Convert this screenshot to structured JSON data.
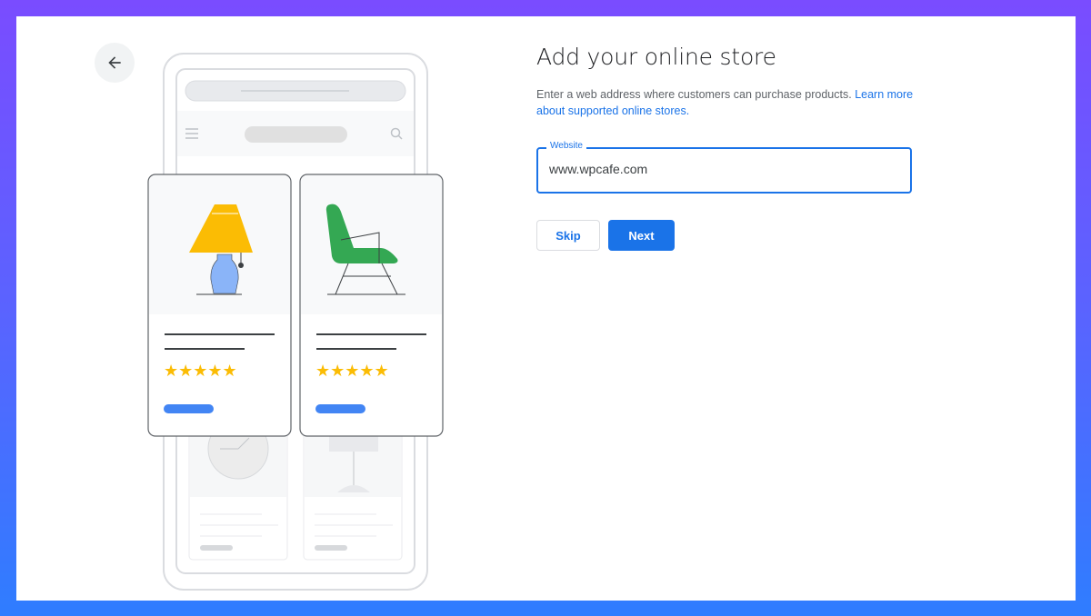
{
  "header": {
    "title": "Add your online store",
    "back_icon": "arrow-left-icon"
  },
  "description": {
    "text": "Enter a web address where customers can purchase products. ",
    "link": "Learn more about supported online stores."
  },
  "website_field": {
    "label": "Website",
    "value": "www.wpcafe.com"
  },
  "actions": {
    "skip": "Skip",
    "next": "Next"
  },
  "illustration": {
    "products": [
      {
        "name": "lamp",
        "rating": 5
      },
      {
        "name": "chair",
        "rating": 5
      }
    ],
    "colors": {
      "accent": "#4285f4",
      "star": "#fbbc04",
      "lamp_shade": "#fbbc04",
      "lamp_base": "#8ab4f8",
      "chair": "#34a853"
    }
  }
}
